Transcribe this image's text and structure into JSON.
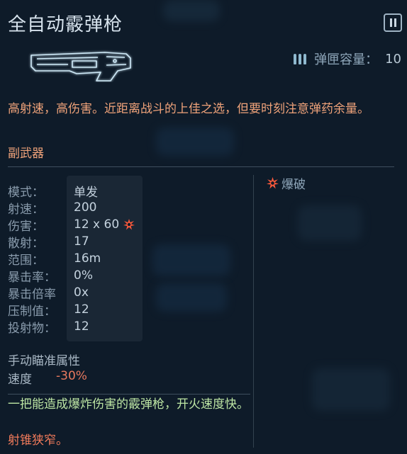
{
  "weapon": {
    "name": "全自动霰弹枪",
    "magazine_label": "弹匣容量：",
    "magazine_value": "10",
    "description": "高射速，高伤害。近距离战斗的上佳之选，但要时刻注意弹药余量。",
    "category": "副武器",
    "icon": "shotgun-icon"
  },
  "controls": {
    "pause_icon": "pause-icon"
  },
  "stats": [
    {
      "label": "模式：",
      "value": "单发"
    },
    {
      "label": "射速：",
      "value": "200"
    },
    {
      "label": "伤害：",
      "value": "12 x 60",
      "icon": "explosive-damage-icon"
    },
    {
      "label": "散射：",
      "value": "17"
    },
    {
      "label": "范围：",
      "value": "16m"
    },
    {
      "label": "暴击率：",
      "value": "0%"
    },
    {
      "label": "暴击倍率",
      "value": "0x"
    },
    {
      "label": "压制值：",
      "value": "12"
    },
    {
      "label": "投射物：",
      "value": "12"
    }
  ],
  "traits": [
    {
      "label": "爆破",
      "icon": "explosive-icon"
    }
  ],
  "manual_aim": {
    "title": "手动瞄准属性",
    "speed_label": "速度",
    "speed_value": "-30%"
  },
  "perks": {
    "positive": "一把能造成爆炸伤害的霰弹枪，开火速度快。",
    "negative": "射锥狭窄。"
  },
  "colors": {
    "background": "#0e1b29",
    "highlight_orange": "#f0a37a",
    "positive_green": "#bde6a4",
    "negative_red": "#f07a5a",
    "explosive_icon": "#ff5a3c"
  }
}
